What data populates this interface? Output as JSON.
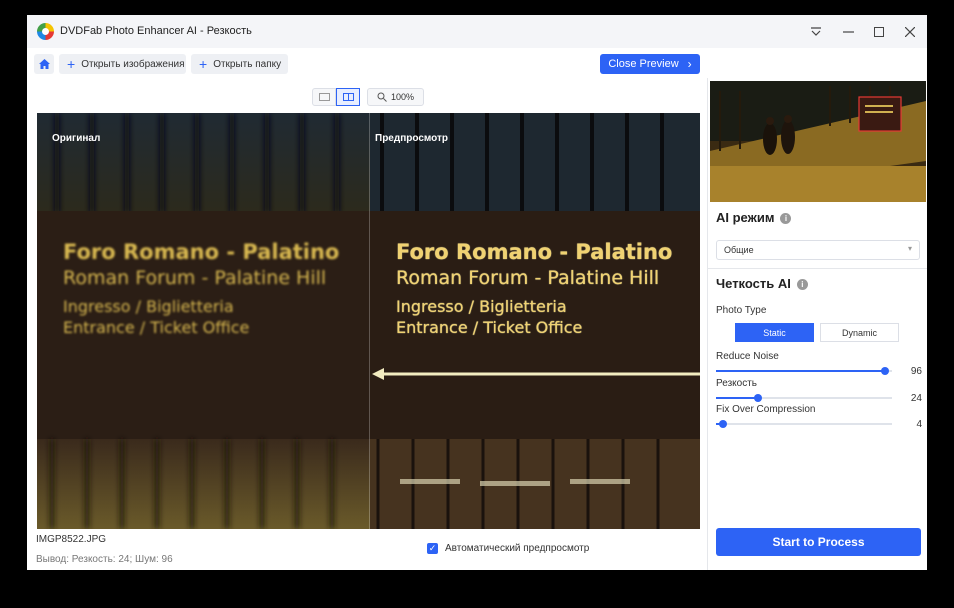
{
  "window": {
    "title": "DVDFab Photo Enhancer AI - Резкость"
  },
  "toolbar": {
    "open_images_label": "Открыть изображения",
    "open_folder_label": "Открыть папку",
    "close_preview_label": "Close Preview"
  },
  "view": {
    "zoom": "100%"
  },
  "preview": {
    "original_label": "Оригинал",
    "preview_label": "Предпросмотр",
    "sign_lines": [
      "Foro Romano - Palatino",
      "Roman Forum - Palatine Hill",
      "Ingresso / Biglietteria",
      "Entrance / Ticket Office"
    ]
  },
  "file": {
    "name": "IMGP8522.JPG",
    "output": "Вывод: Резкость: 24; Шум: 96"
  },
  "auto_preview": {
    "label": "Автоматический предпросмотр",
    "checked": true
  },
  "sidebar": {
    "ai_mode_title": "AI режим",
    "ai_mode_value": "Общие",
    "clarity_title": "Четкость AI",
    "photo_type_label": "Photo Type",
    "photo_type_options": [
      "Static",
      "Dynamic"
    ],
    "photo_type_selected": "Static",
    "sliders": [
      {
        "label": "Reduce Noise",
        "value": "96",
        "fraction": 0.96
      },
      {
        "label": "Резкость",
        "value": "24",
        "fraction": 0.24
      },
      {
        "label": "Fix Over Compression",
        "value": "4",
        "fraction": 0.04
      }
    ],
    "process_label": "Start to Process"
  },
  "colors": {
    "accent": "#2d63f5",
    "sign_text": "#e8c45a"
  }
}
